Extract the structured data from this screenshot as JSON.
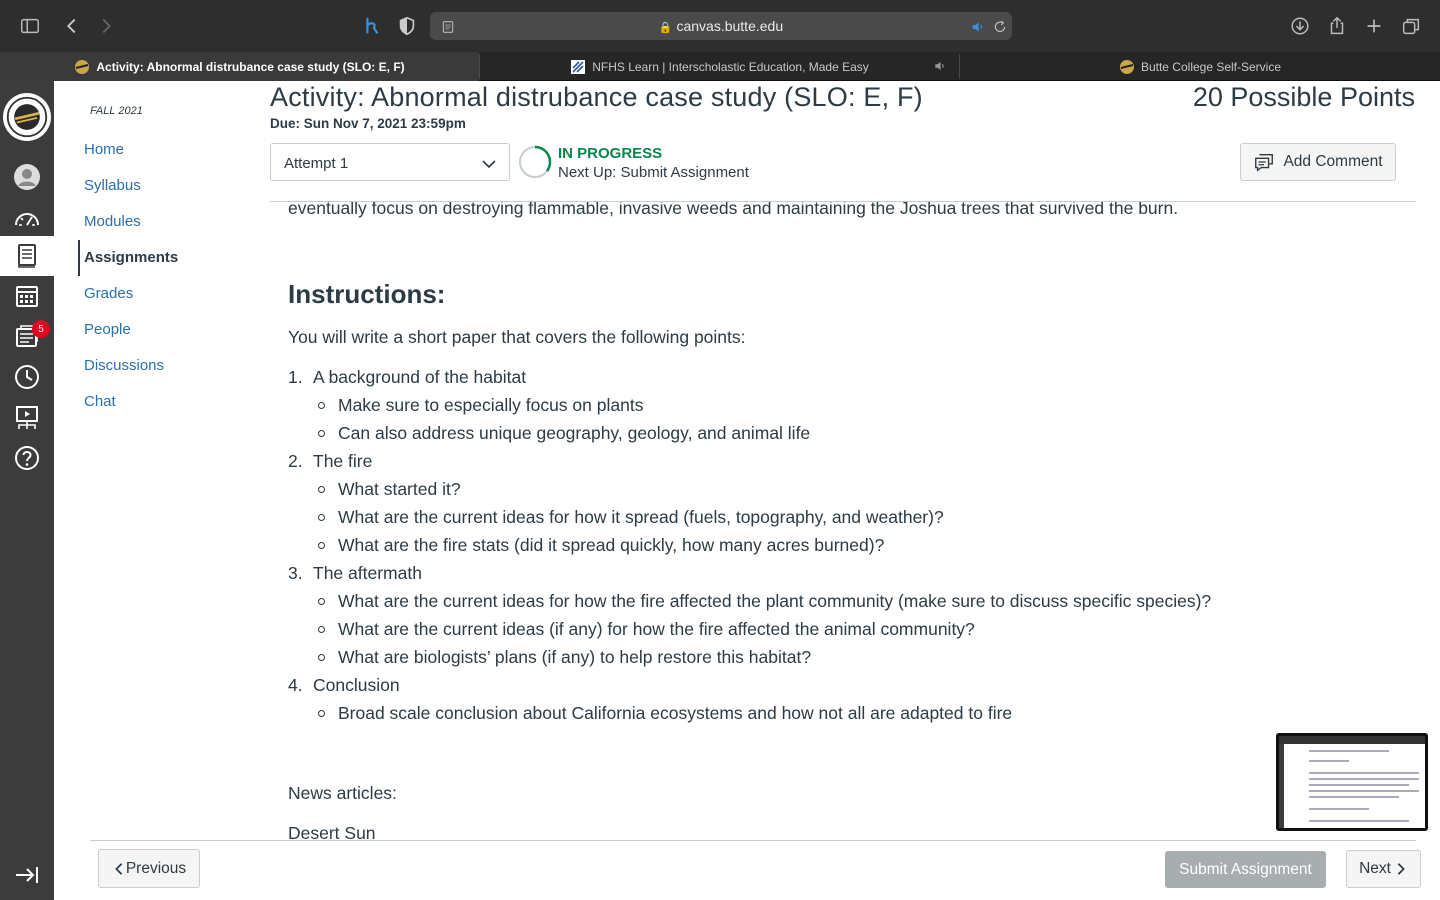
{
  "browser": {
    "address": "canvas.butte.edu",
    "tabs": [
      {
        "title": "Activity: Abnormal distrubance case study (SLO: E, F)",
        "active": true
      },
      {
        "title": "NFHS Learn | Interscholastic Education, Made Easy",
        "active": false
      },
      {
        "title": "Butte College Self-Service",
        "active": false
      }
    ]
  },
  "global_nav": {
    "badge_count": "5",
    "items": [
      "account-icon",
      "dashboard-icon",
      "courses-icon",
      "calendar-icon",
      "inbox-icon",
      "history-icon",
      "studio-icon",
      "help-icon"
    ]
  },
  "course_nav": {
    "term": "FALL 2021",
    "items": [
      "Home",
      "Syllabus",
      "Modules",
      "Assignments",
      "Grades",
      "People",
      "Discussions",
      "Chat"
    ],
    "active": "Assignments"
  },
  "header": {
    "title": "Activity: Abnormal distrubance case study (SLO: E, F)",
    "due": "Due: Sun Nov 7, 2021 23:59pm",
    "points": "20 Possible Points",
    "attempt": "Attempt 1",
    "status": "IN PROGRESS",
    "next_up": "Next Up: Submit Assignment",
    "add_comment": "Add Comment"
  },
  "content": {
    "clipped_line": "eventually focus on destroying flammable, invasive weeds and maintaining the Joshua trees that survived the burn.",
    "instructions_heading": "Instructions:",
    "intro": "You will write a short paper that covers the following points:",
    "points": [
      {
        "num": "1.",
        "text": "A background of the habitat",
        "subs": [
          "Make sure to especially focus on plants",
          "Can also address unique geography, geology, and animal life"
        ]
      },
      {
        "num": "2.",
        "text": "The fire",
        "subs": [
          "What started it?",
          "What are the current ideas for how it spread (fuels, topography, and weather)?",
          "What are the fire stats (did it spread quickly, how many acres burned)?"
        ]
      },
      {
        "num": "3.",
        "text": "The aftermath",
        "subs": [
          "What are the current ideas for how the fire affected the plant community (make sure to discuss specific species)?",
          "What are the current ideas (if any) for how the fire affected the animal community?",
          "What are biologists’ plans (if any) to help restore this habitat?"
        ]
      },
      {
        "num": "4.",
        "text": "Conclusion",
        "subs": [
          "Broad scale conclusion about California ecosystems and how not all are adapted to fire"
        ]
      }
    ],
    "news_label": "News articles:",
    "news_source": "Desert Sun"
  },
  "footer": {
    "previous": "Previous",
    "submit": "Submit Assignment",
    "next": "Next"
  }
}
